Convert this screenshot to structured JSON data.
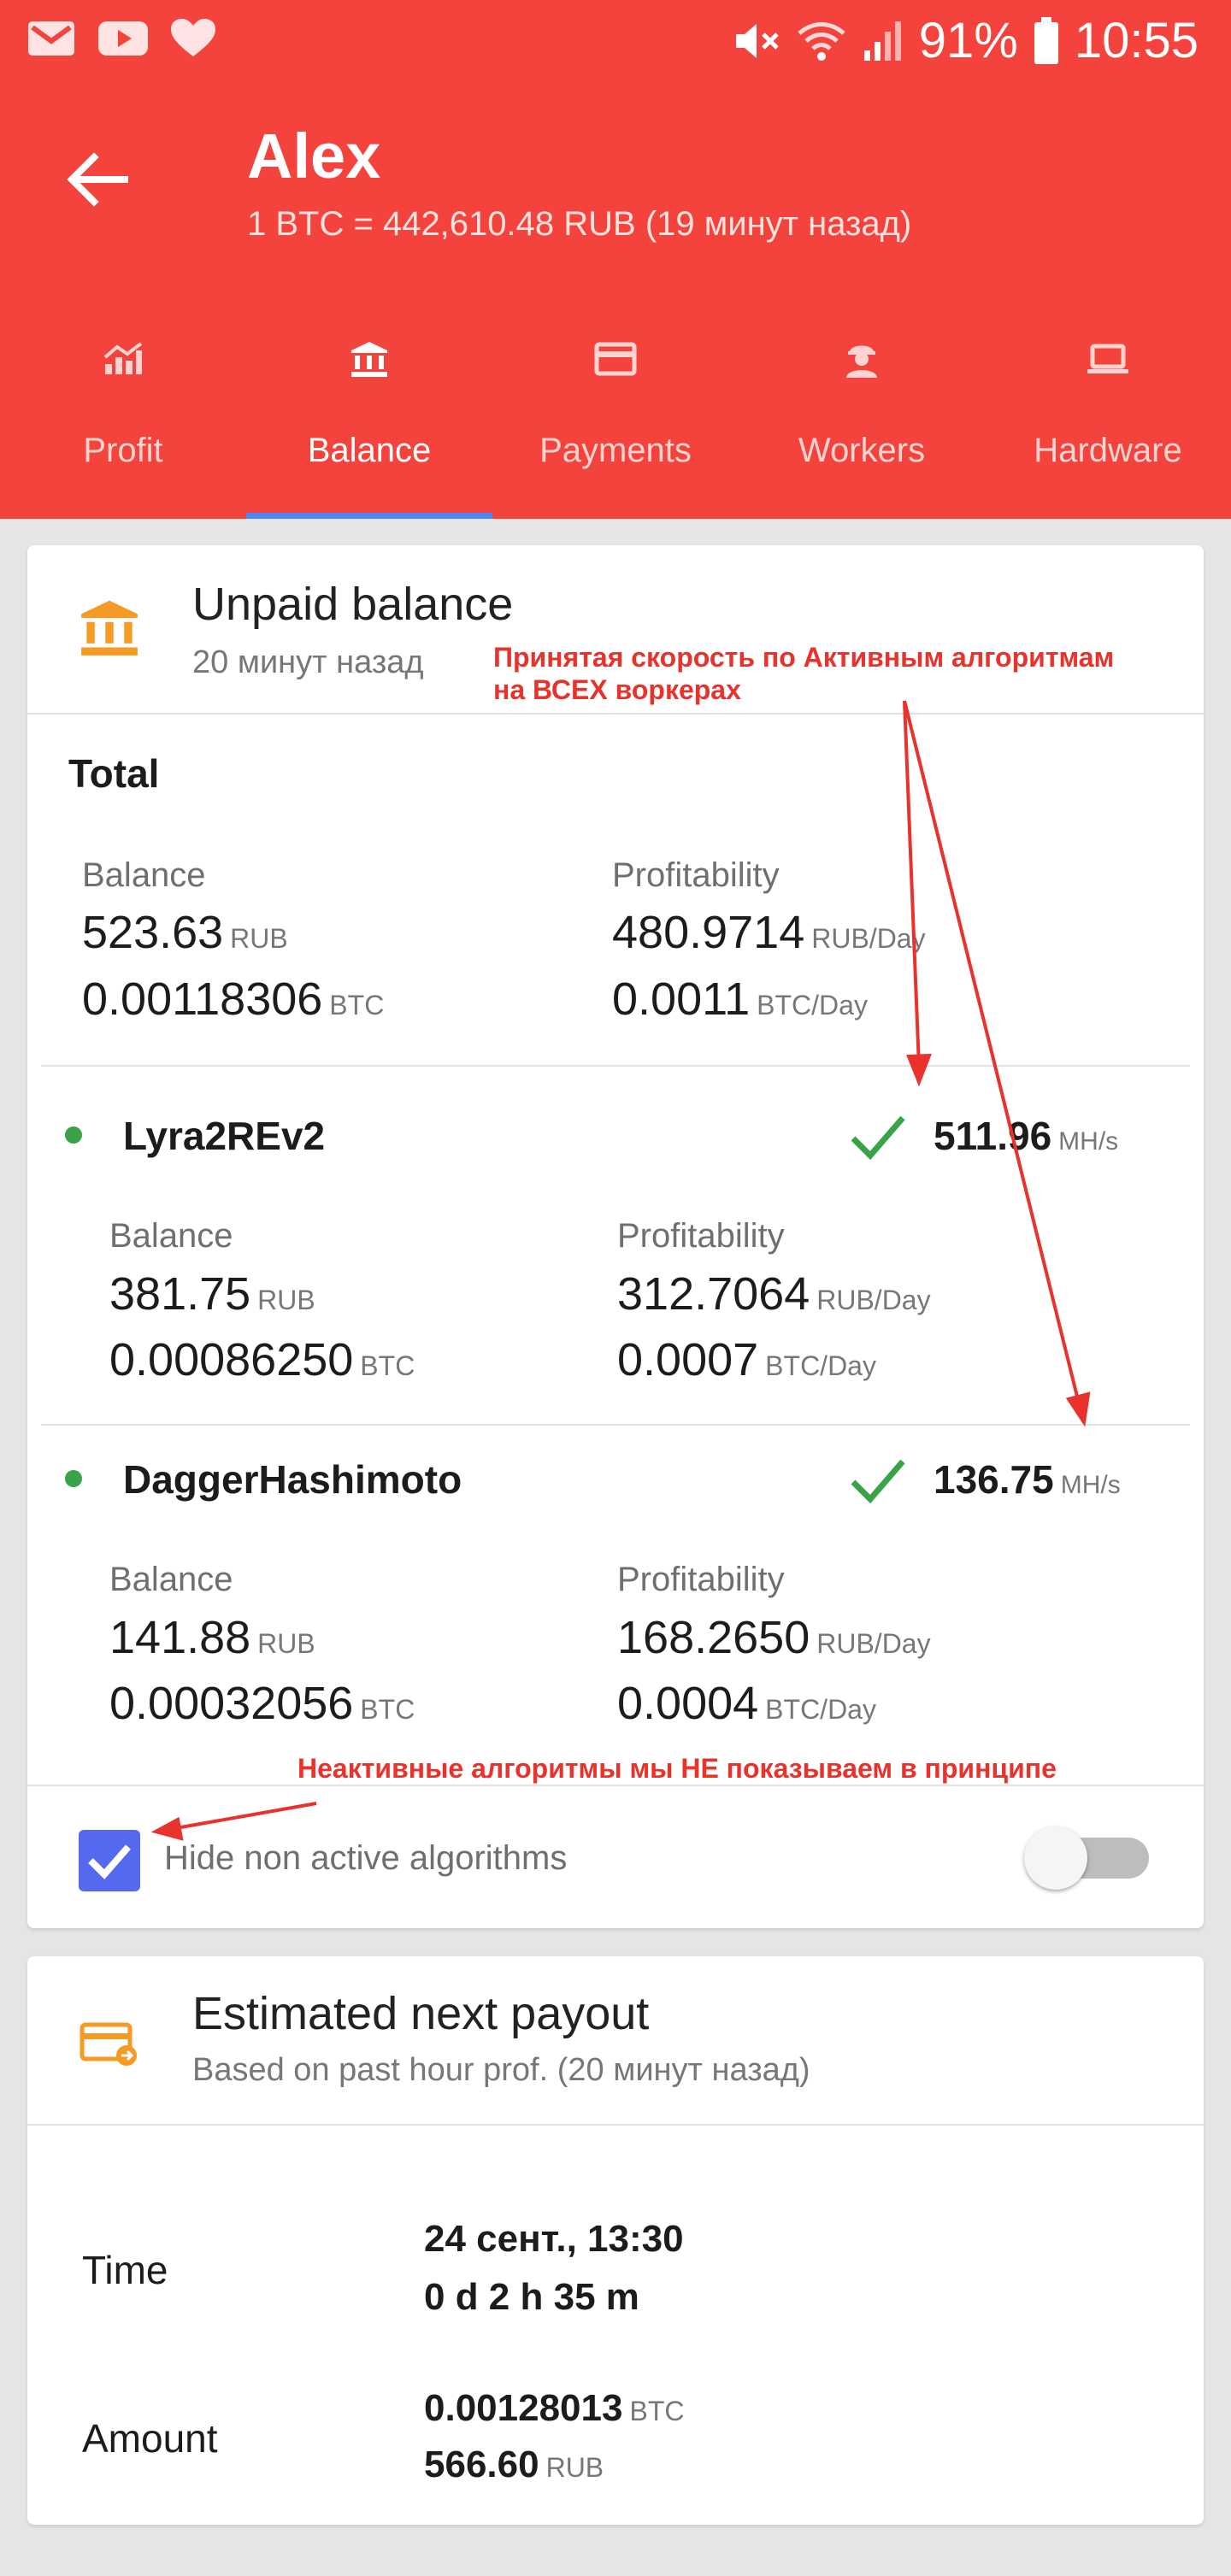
{
  "status_bar": {
    "battery": "91%",
    "time": "10:55",
    "left_icons": [
      "gmail-icon",
      "youtube-icon",
      "heart-icon"
    ],
    "right_icons": [
      "mute-icon",
      "wifi-icon",
      "signal-icon",
      "battery-icon"
    ]
  },
  "header": {
    "title": "Alex",
    "subtitle": "1 BTC = 442,610.48 RUB (19 минут назад)",
    "background": "#f4433c",
    "tab_indicator_color": "#4a86f4"
  },
  "tabs": [
    {
      "label": "Profit",
      "icon": "chart-icon",
      "active": false
    },
    {
      "label": "Balance",
      "icon": "bank-icon",
      "active": true
    },
    {
      "label": "Payments",
      "icon": "credit-card-icon",
      "active": false
    },
    {
      "label": "Workers",
      "icon": "worker-icon",
      "active": false
    },
    {
      "label": "Hardware",
      "icon": "laptop-icon",
      "active": false
    }
  ],
  "unpaid": {
    "title": "Unpaid balance",
    "subtitle": "20 минут назад",
    "icon": "bank-icon",
    "accent": "#f59a23",
    "total": {
      "heading": "Total",
      "balance_label": "Balance",
      "balance_rub": "523.63",
      "balance_btc": "0.00118306",
      "profit_label": "Profitability",
      "profit_rub": "480.9714",
      "profit_btc": "0.0011"
    },
    "algorithms": [
      {
        "name": "Lyra2REv2",
        "speed": "511.96",
        "speed_unit": "MH/s",
        "balance_label": "Balance",
        "balance_rub": "381.75",
        "balance_btc": "0.00086250",
        "profit_label": "Profitability",
        "profit_rub": "312.7064",
        "profit_btc": "0.0007"
      },
      {
        "name": "DaggerHashimoto",
        "speed": "136.75",
        "speed_unit": "MH/s",
        "balance_label": "Balance",
        "balance_rub": "141.88",
        "balance_btc": "0.00032056",
        "profit_label": "Profitability",
        "profit_rub": "168.2650",
        "profit_btc": "0.0004"
      }
    ],
    "hide_inactive": {
      "label": "Hide non active algorithms",
      "checked": true,
      "toggle_on": false
    }
  },
  "units": {
    "rub": "RUB",
    "btc": "BTC",
    "rub_day": "RUB/Day",
    "btc_day": "BTC/Day"
  },
  "payout": {
    "title": "Estimated next payout",
    "subtitle": "Based on past hour prof. (20 минут назад)",
    "icon": "payout-card-icon",
    "time_label": "Time",
    "time_date": "24 сент., 13:30",
    "time_remaining": "0 d 2 h 35 m",
    "amount_label": "Amount",
    "amount_btc": "0.00128013",
    "amount_rub": "566.60"
  },
  "annotations": {
    "top_line1": "Принятая скорость по Активным алгоритмам",
    "top_line2": "на ВСЕХ воркерах",
    "bottom": "Неактивные алгоритмы мы НЕ показываем в принципе",
    "color": "#e8322b"
  }
}
